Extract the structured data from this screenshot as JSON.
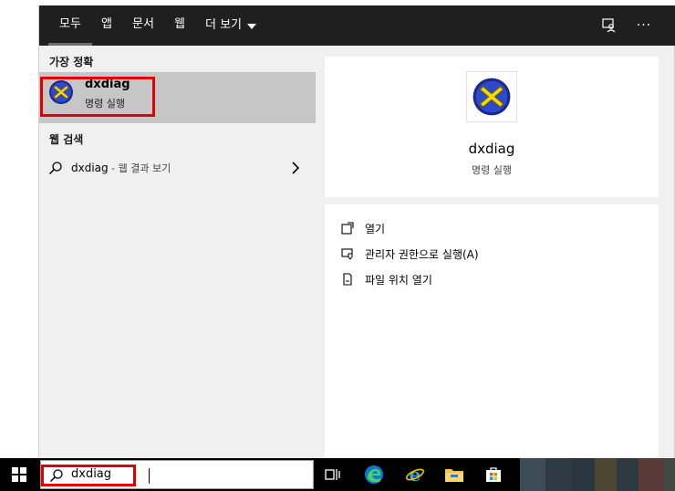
{
  "tabs": [
    {
      "label": "모두",
      "active": true
    },
    {
      "label": "앱",
      "active": false
    },
    {
      "label": "문서",
      "active": false
    },
    {
      "label": "웹",
      "active": false
    },
    {
      "label": "더 보기",
      "active": false
    }
  ],
  "toolbar_icons": [
    "feedback-icon",
    "more-options-icon"
  ],
  "more_label": "···",
  "best_match": {
    "section_title": "가장 정확",
    "title": "dxdiag",
    "subtitle": "명령 실행",
    "icon": "directx-icon"
  },
  "web_search": {
    "section_title": "웹 검색",
    "query": "dxdiag",
    "suffix": " - 웹 결과 보기"
  },
  "preview": {
    "title": "dxdiag",
    "subtitle": "명령 실행"
  },
  "actions": [
    {
      "label": "열기",
      "icon": "open-icon"
    },
    {
      "label": "관리자 권한으로 실행(A)",
      "icon": "run-as-admin-icon"
    },
    {
      "label": "파일 위치 열기",
      "icon": "file-location-icon"
    }
  ],
  "taskbar": {
    "search_value": "dxdiag",
    "apps": [
      "start-icon",
      "task-view-icon",
      "edge-icon",
      "internet-explorer-icon",
      "file-explorer-icon",
      "store-icon"
    ]
  },
  "colors": {
    "topbar": "#1f1f1f",
    "highlight": "#c6c6c6",
    "annotation_red": "#e10000"
  }
}
